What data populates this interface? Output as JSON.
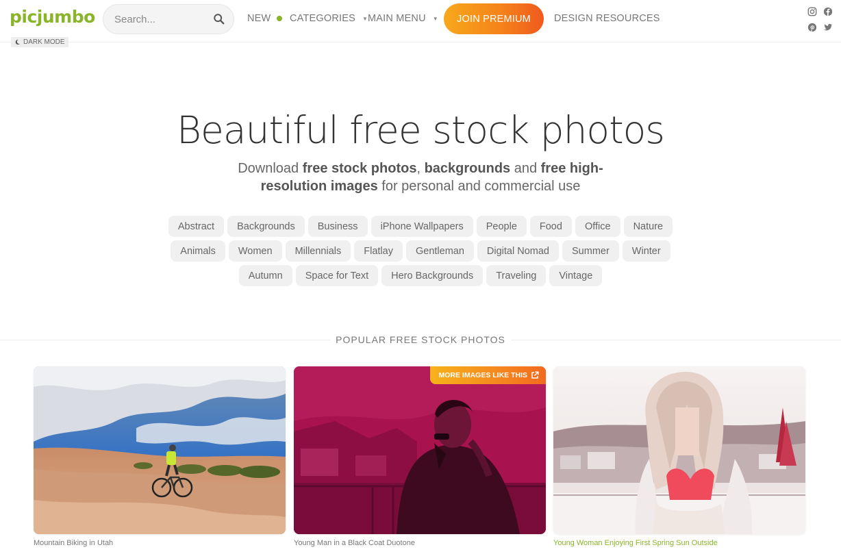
{
  "header": {
    "logo": "picjumbo",
    "dark_mode_label": "DARK MODE",
    "search_placeholder": "Search...",
    "nav": {
      "new": "NEW",
      "categories": "CATEGORIES",
      "main_menu": "MAIN MENU",
      "join_premium": "JOIN PREMIUM",
      "design_resources": "DESIGN RESOURCES"
    },
    "social_icons": [
      "instagram-icon",
      "facebook-icon",
      "pinterest-icon",
      "twitter-icon"
    ]
  },
  "hero": {
    "title": "Beautiful free stock photos",
    "subtitle": {
      "p1": "Download ",
      "b1": "free stock photos",
      "p2": ", ",
      "b2": "backgrounds",
      "p3": " and ",
      "b3": "free high-resolution images",
      "p4": " for personal and commercial use"
    }
  },
  "tags": {
    "row1": [
      "Abstract",
      "Backgrounds",
      "Business",
      "iPhone Wallpapers",
      "People",
      "Food",
      "Office",
      "Nature"
    ],
    "row2": [
      "Animals",
      "Women",
      "Millennials",
      "Flatlay",
      "Gentleman",
      "Digital Nomad",
      "Summer",
      "Winter"
    ],
    "row3": [
      "Autumn",
      "Space for Text",
      "Hero Backgrounds",
      "Traveling",
      "Vintage"
    ]
  },
  "popular": {
    "section_title": "POPULAR FREE STOCK PHOTOS",
    "more_images_label": "MORE IMAGES LIKE THIS",
    "photos": [
      {
        "caption": "Mountain Biking in Utah"
      },
      {
        "caption": "Young Man in a Black Coat Duotone"
      },
      {
        "caption": "Young Woman Enjoying First Spring Sun Outside"
      }
    ]
  },
  "colors": {
    "brand_green": "#8ab42a",
    "premium_gradient_start": "#f7a81b",
    "premium_gradient_end": "#ef5a1e",
    "duotone_magenta": "#a8124f"
  }
}
